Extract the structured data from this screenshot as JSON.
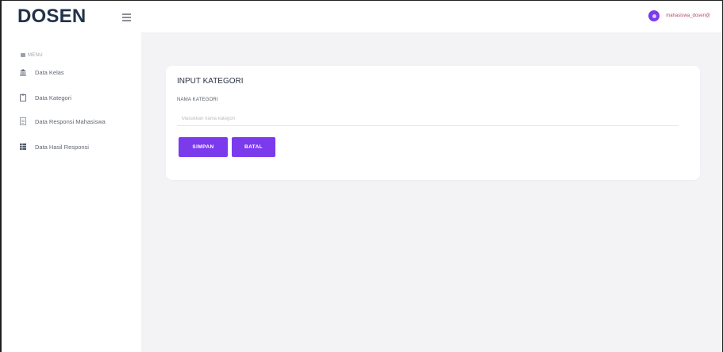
{
  "brand": "DOSEN",
  "user": {
    "name": "mahasiswa_dosen@"
  },
  "sidebar": {
    "section_label": "MENU",
    "items": [
      {
        "label": "Data Kelas",
        "icon": "building-icon"
      },
      {
        "label": "Data Kategori",
        "icon": "clipboard-icon"
      },
      {
        "label": "Data Responsi Mahasiswa",
        "icon": "document-icon"
      },
      {
        "label": "Data Hasil Responsi",
        "icon": "table-icon"
      }
    ]
  },
  "form": {
    "title": "INPUT KATEGORI",
    "field_label": "NAMA KATEGORI",
    "field_placeholder": "Masukkan nama kategori",
    "field_value": "",
    "save_label": "SIMPAN",
    "cancel_label": "BATAL"
  },
  "colors": {
    "accent": "#7c3aed",
    "content_bg": "#f3f3f6",
    "brand_text": "#22324a"
  }
}
